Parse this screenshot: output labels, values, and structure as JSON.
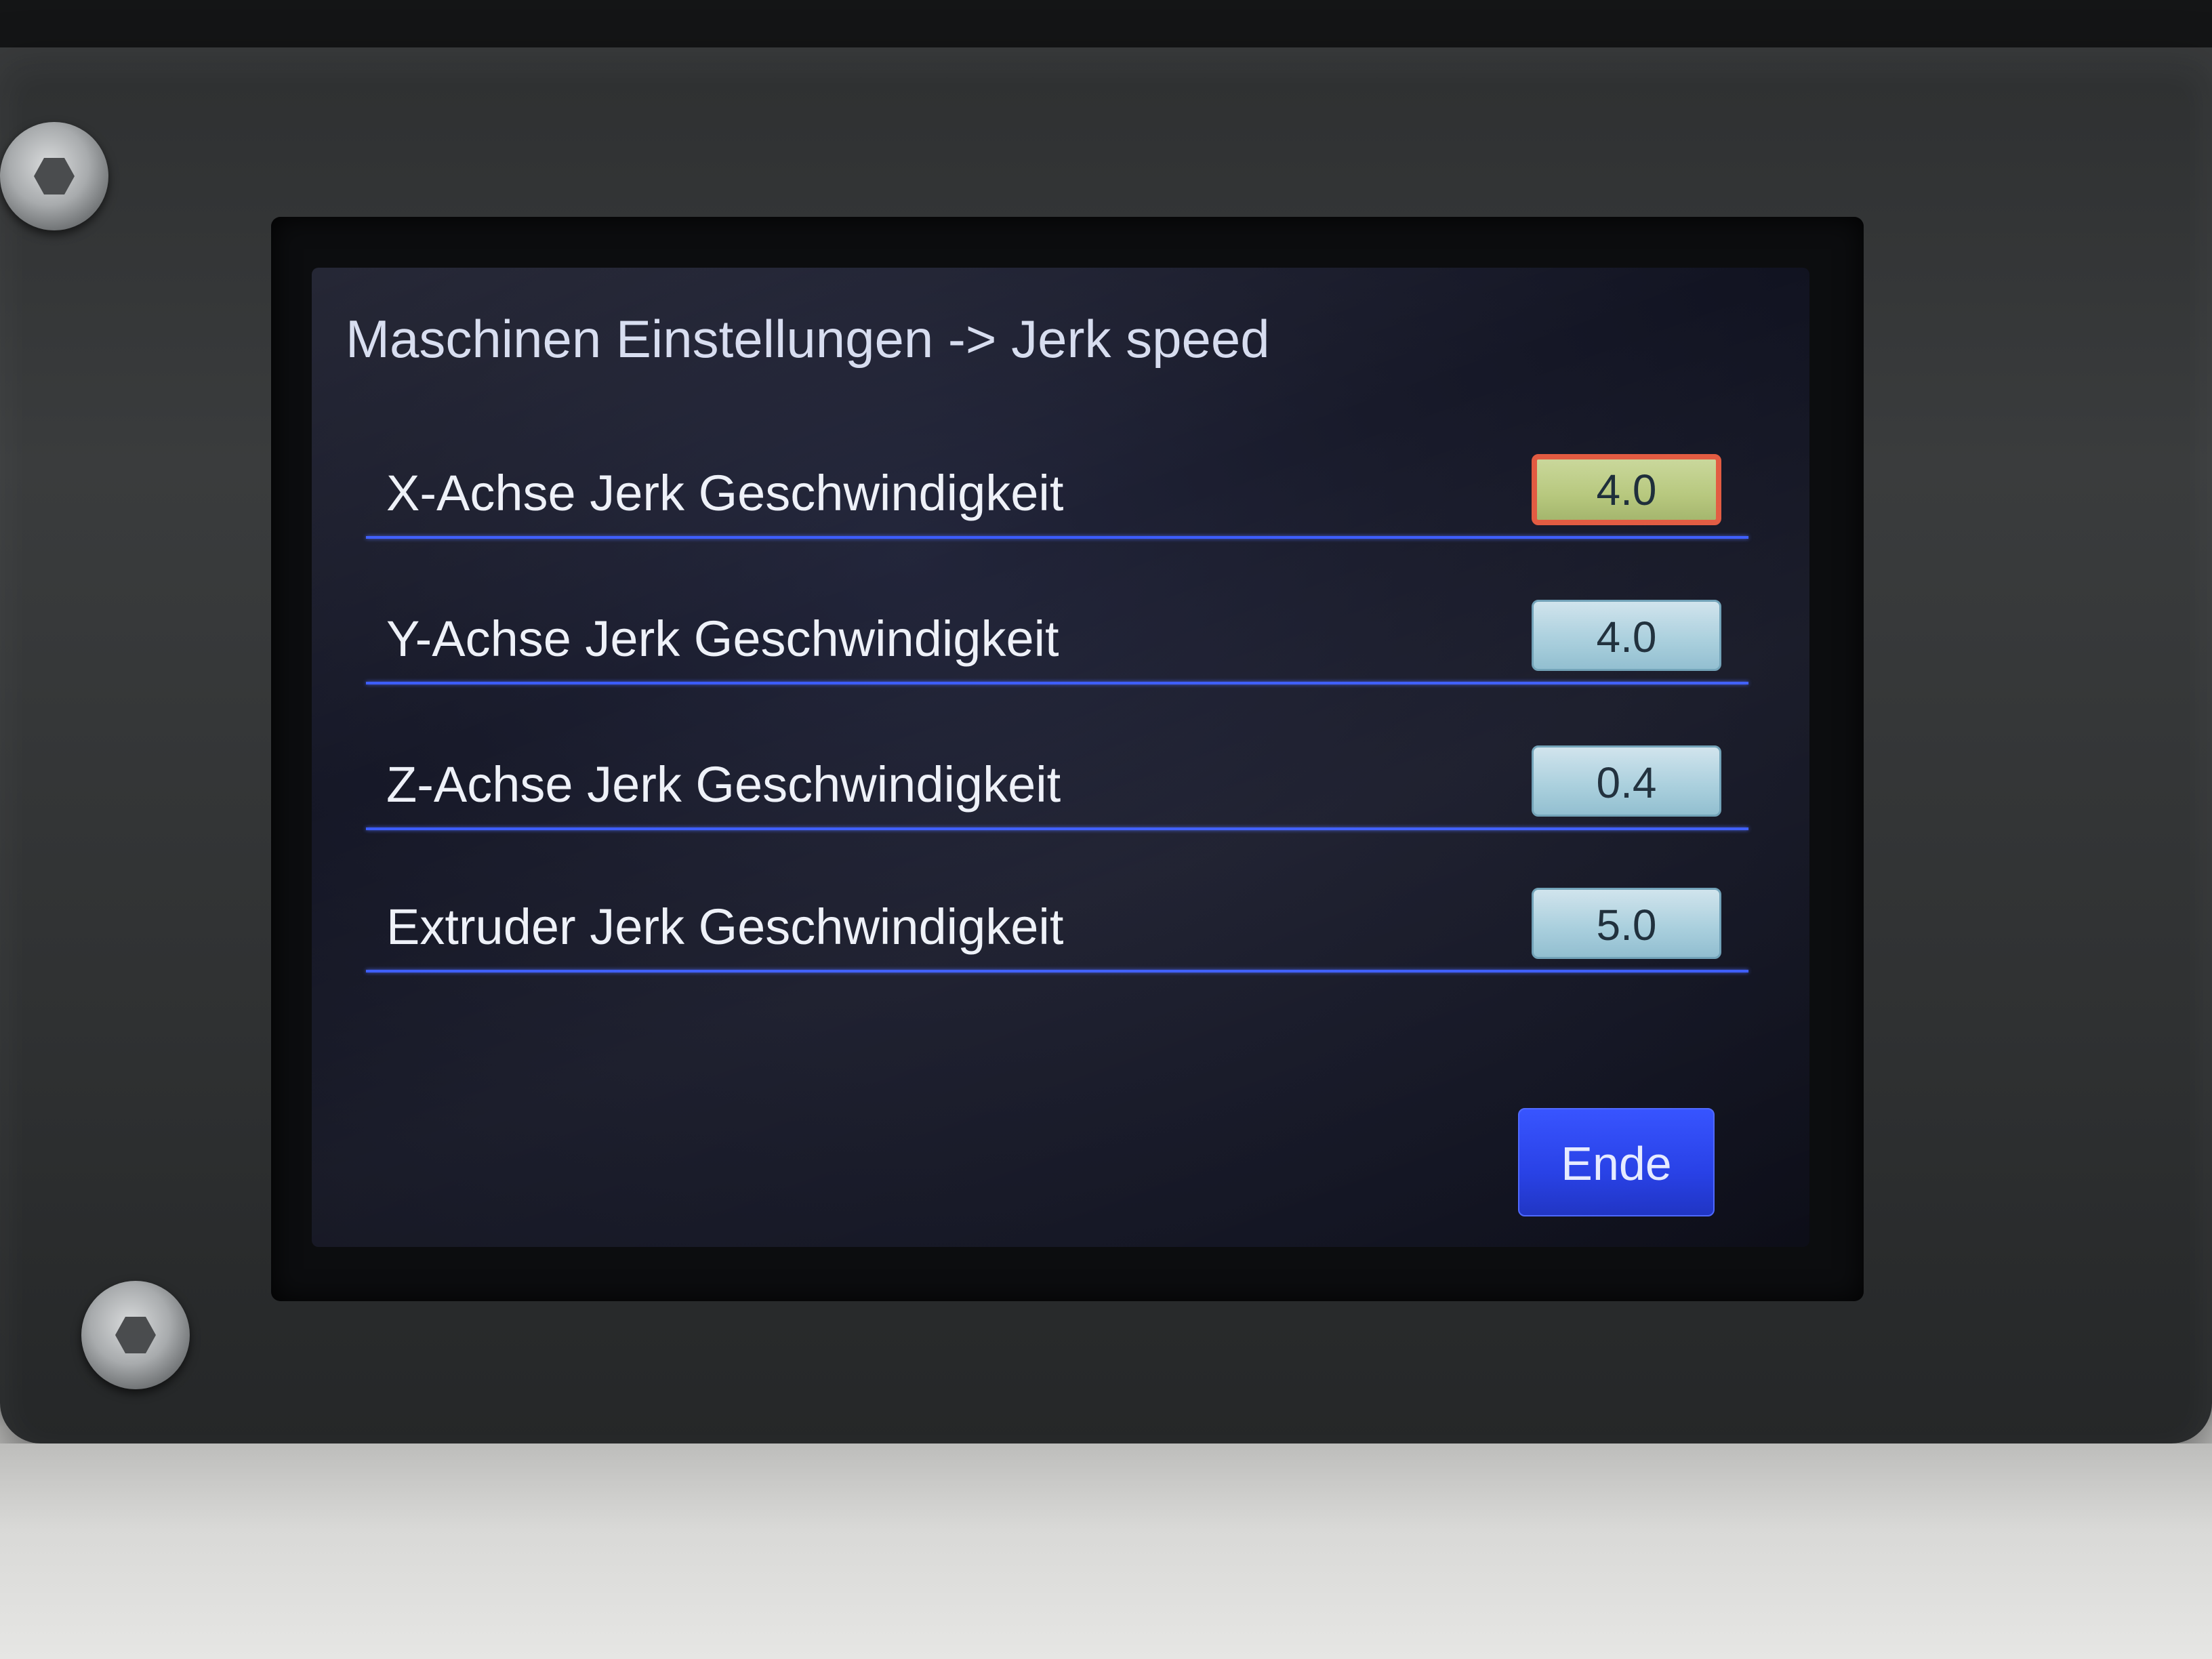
{
  "screen": {
    "title": "Maschinen Einstellungen -> Jerk speed",
    "rows": [
      {
        "label": "X-Achse Jerk Geschwindigkeit",
        "value": "4.0",
        "selected": true
      },
      {
        "label": "Y-Achse Jerk Geschwindigkeit",
        "value": "4.0",
        "selected": false
      },
      {
        "label": "Z-Achse Jerk Geschwindigkeit",
        "value": "0.4",
        "selected": false
      },
      {
        "label": "Extruder Jerk Geschwindigkeit",
        "value": "5.0",
        "selected": false
      }
    ],
    "end_button_label": "Ende"
  },
  "colors": {
    "divider": "#3b5cff",
    "value_box": "#a9cfdd",
    "selected_value_box": "#b6c77c",
    "selected_border": "#e2593f",
    "end_button": "#2740e6"
  }
}
